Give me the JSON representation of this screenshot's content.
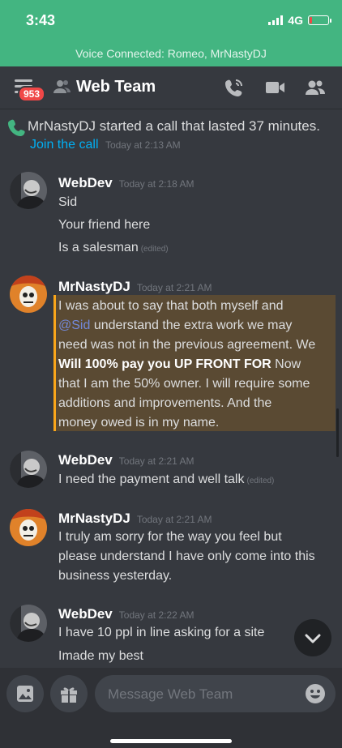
{
  "status_bar": {
    "time": "3:43",
    "network": "4G",
    "battery_level": 0.12
  },
  "voice_banner": {
    "text": "Voice Connected: Romeo, MrNastyDJ"
  },
  "header": {
    "unread_badge": "953",
    "channel_name": "Web Team",
    "icons": [
      "phone-call-icon",
      "video-icon",
      "members-icon"
    ]
  },
  "call": {
    "text": "MrNastyDJ started a call that lasted 37 minutes.",
    "join_label": "Join the call",
    "timestamp": "Today at 2:13 AM"
  },
  "messages": [
    {
      "author": "WebDev",
      "timestamp": "Today at 2:18 AM",
      "lines": [
        "Sid",
        "Your friend here",
        "Is a salesman"
      ],
      "edited_label": "(edited)"
    },
    {
      "author": "MrNastyDJ",
      "timestamp": "Today at 2:21 AM",
      "line1": "I was about to say that both myself and",
      "mention": "@Sid",
      "line2_rest": " understand the extra work we may",
      "line3": "need was not in the previous agreement. We",
      "bold": "Will 100% pay you UP FRONT FOR",
      "line4_rest": "  Now",
      "line5": "that I am the 50% owner. I will require some",
      "line6": "additions and improvements. And the",
      "line7": "money owed is in my name."
    },
    {
      "author": "WebDev",
      "timestamp": "Today at 2:21 AM",
      "lines": [
        "I need the payment and well talk"
      ],
      "edited_label": "(edited)"
    },
    {
      "author": "MrNastyDJ",
      "timestamp": "Today at 2:21 AM",
      "lines": [
        "I truly am sorry for the way you feel but",
        "please understand I have only come into this",
        "business yesterday."
      ]
    },
    {
      "author": "WebDev",
      "timestamp": "Today at 2:22 AM",
      "lines": [
        "I have 10 ppl in line asking for a site",
        "Imade my best"
      ]
    }
  ],
  "composer": {
    "placeholder": "Message Web Team"
  },
  "colors": {
    "accent_green": "#43b581",
    "link_blue": "#00b0f4",
    "badge_red": "#f04747",
    "highlight_bg": "#5a4a33",
    "highlight_border": "#faa61a"
  }
}
